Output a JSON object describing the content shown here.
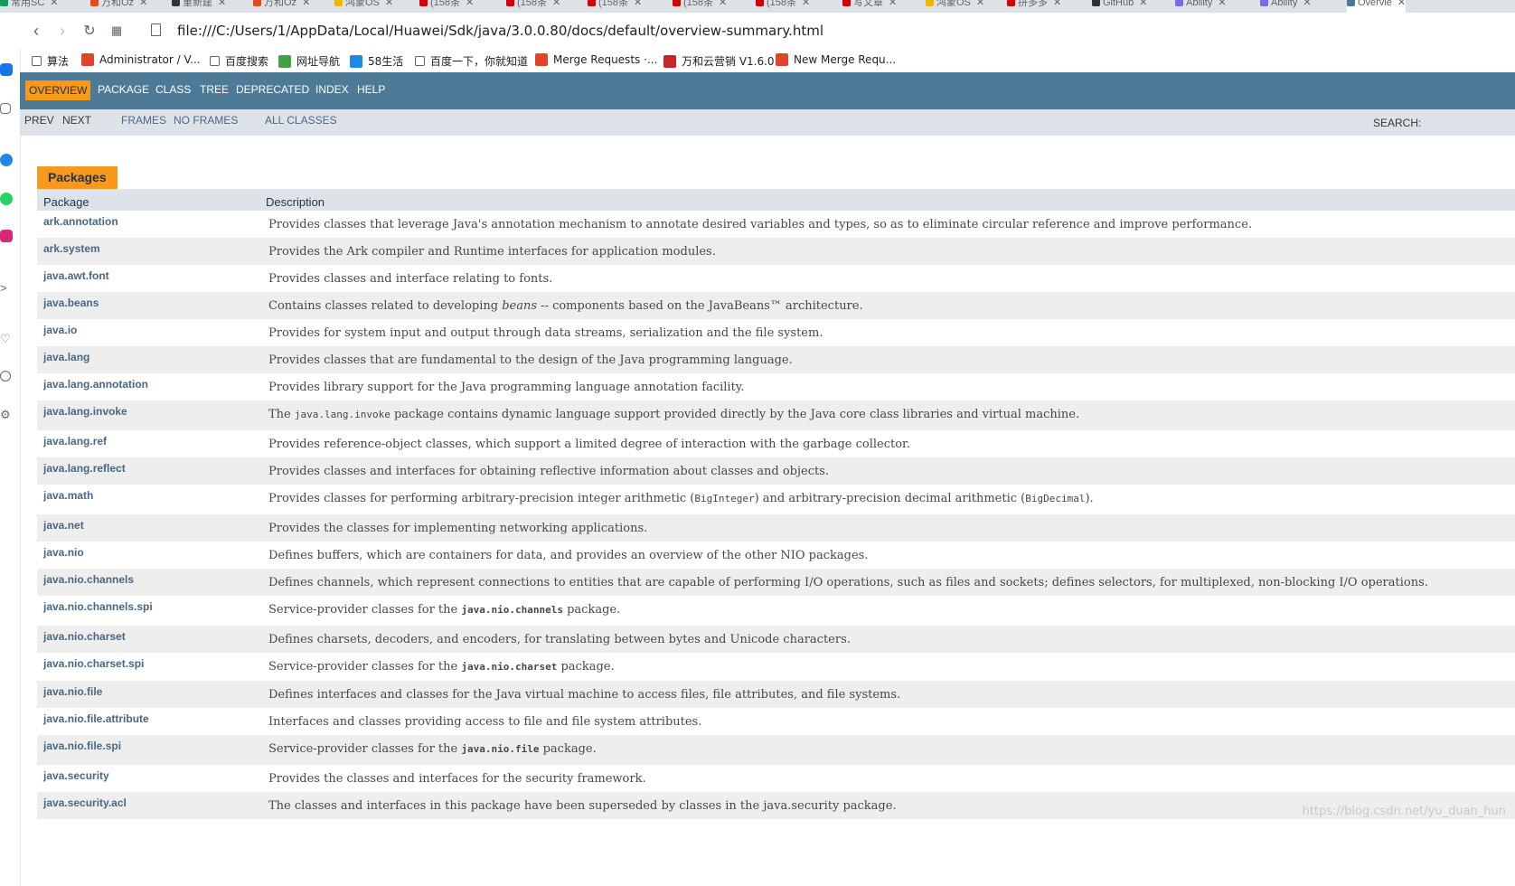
{
  "browser": {
    "tabs": [
      {
        "label": "常用SC"
      },
      {
        "label": "万和Oz"
      },
      {
        "label": "重新建"
      },
      {
        "label": "万和Oz"
      },
      {
        "label": "鸿蒙OS"
      },
      {
        "label": "(158条"
      },
      {
        "label": "(158条"
      },
      {
        "label": "(158条"
      },
      {
        "label": "(158条"
      },
      {
        "label": "(158条"
      },
      {
        "label": "写文章"
      },
      {
        "label": "鸿蒙OS"
      },
      {
        "label": "拼多多"
      },
      {
        "label": "GitHub"
      },
      {
        "label": "Ability"
      },
      {
        "label": "Ability"
      },
      {
        "label": "Overvie"
      }
    ],
    "url": "file:///C:/Users/1/AppData/Local/Huawei/Sdk/java/3.0.0.80/docs/default/overview-summary.html",
    "bookmarks": [
      {
        "label": "算法"
      },
      {
        "label": "Administrator / V..."
      },
      {
        "label": "百度搜索"
      },
      {
        "label": "网址导航"
      },
      {
        "label": "58生活"
      },
      {
        "label": "百度一下，你就知道"
      },
      {
        "label": "Merge Requests ·..."
      },
      {
        "label": "万和云营销 V1.6.0"
      },
      {
        "label": "New Merge Requ..."
      }
    ]
  },
  "nav": {
    "overview": "OVERVIEW",
    "package": "PACKAGE",
    "class": "CLASS",
    "tree": "TREE",
    "deprecated": "DEPRECATED",
    "index": "INDEX",
    "help": "HELP"
  },
  "subnav": {
    "prev": "PREV",
    "next": "NEXT",
    "frames": "FRAMES",
    "no_frames": "NO FRAMES",
    "all_classes": "ALL CLASSES",
    "search": "SEARCH:"
  },
  "table": {
    "caption": "Packages",
    "col_package": "Package",
    "col_description": "Description",
    "rows": [
      {
        "name": "ark.annotation",
        "desc": "Provides classes that leverage Java's annotation mechanism to annotate desired variables and types, so as to eliminate circular reference and improve performance."
      },
      {
        "name": "ark.system",
        "desc": "Provides the Ark compiler and Runtime interfaces for application modules."
      },
      {
        "name": "java.awt.font",
        "desc": "Provides classes and interface relating to fonts."
      },
      {
        "name": "java.beans",
        "desc_pre": "Contains classes related to developing ",
        "desc_em": "beans",
        "desc_post": " -- components based on the JavaBeans™ architecture."
      },
      {
        "name": "java.io",
        "desc": "Provides for system input and output through data streams, serialization and the file system."
      },
      {
        "name": "java.lang",
        "desc": "Provides classes that are fundamental to the design of the Java programming language."
      },
      {
        "name": "java.lang.annotation",
        "desc": "Provides library support for the Java programming language annotation facility."
      },
      {
        "name": "java.lang.invoke",
        "desc_pre": "The ",
        "desc_code": "java.lang.invoke",
        "desc_post": " package contains dynamic language support provided directly by the Java core class libraries and virtual machine."
      },
      {
        "name": "java.lang.ref",
        "desc": "Provides reference-object classes, which support a limited degree of interaction with the garbage collector."
      },
      {
        "name": "java.lang.reflect",
        "desc": "Provides classes and interfaces for obtaining reflective information about classes and objects."
      },
      {
        "name": "java.math",
        "desc_pre": "Provides classes for performing arbitrary-precision integer arithmetic (",
        "desc_code": "BigInteger",
        "desc_mid": ") and arbitrary-precision decimal arithmetic (",
        "desc_code2": "BigDecimal",
        "desc_post": ")."
      },
      {
        "name": "java.net",
        "desc": "Provides the classes for implementing networking applications."
      },
      {
        "name": "java.nio",
        "desc": "Defines buffers, which are containers for data, and provides an overview of the other NIO packages."
      },
      {
        "name": "java.nio.channels",
        "desc": "Defines channels, which represent connections to entities that are capable of performing I/O operations, such as files and sockets; defines selectors, for multiplexed, non-blocking I/O operations."
      },
      {
        "name": "java.nio.channels.spi",
        "desc_pre": "Service-provider classes for the ",
        "desc_codeb": "java.nio.channels",
        "desc_post": " package."
      },
      {
        "name": "java.nio.charset",
        "desc": "Defines charsets, decoders, and encoders, for translating between bytes and Unicode characters."
      },
      {
        "name": "java.nio.charset.spi",
        "desc_pre": "Service-provider classes for the ",
        "desc_codeb": "java.nio.charset",
        "desc_post": " package."
      },
      {
        "name": "java.nio.file",
        "desc": "Defines interfaces and classes for the Java virtual machine to access files, file attributes, and file systems."
      },
      {
        "name": "java.nio.file.attribute",
        "desc": "Interfaces and classes providing access to file and file system attributes."
      },
      {
        "name": "java.nio.file.spi",
        "desc_pre": "Service-provider classes for the ",
        "desc_codeb": "java.nio.file",
        "desc_post": " package."
      },
      {
        "name": "java.security",
        "desc": "Provides the classes and interfaces for the security framework."
      },
      {
        "name": "java.security.acl",
        "desc": "The classes and interfaces in this package have been superseded by classes in the java.security package."
      }
    ]
  },
  "watermark": "https://blog.csdn.net/yu_duan_hun",
  "colors": {
    "nav_bg": "#4d7a97",
    "active_tab": "#f8981d",
    "subnav_bg": "#dee3e9",
    "link": "#4a6782",
    "alt_row": "#eeeeef"
  }
}
